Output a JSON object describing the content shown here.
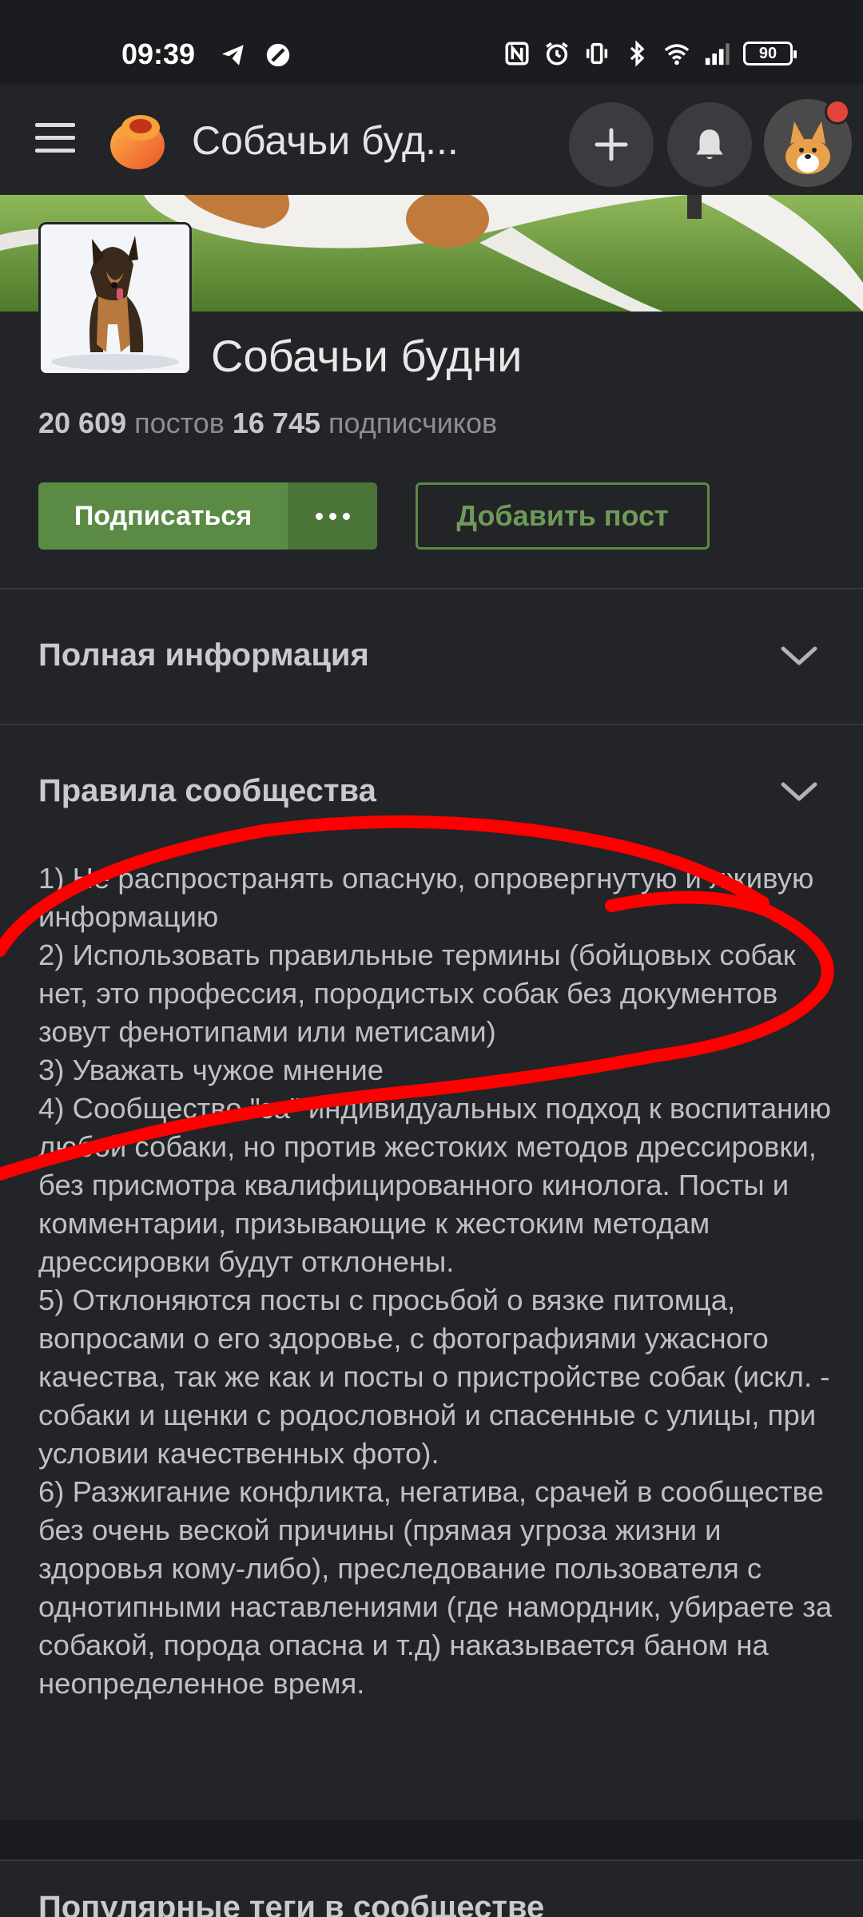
{
  "status_bar": {
    "time": "09:39",
    "battery": "90",
    "icons": [
      "telegram-icon",
      "no-disturb-icon",
      "nfc-icon",
      "alarm-icon",
      "vibrate-icon",
      "bluetooth-icon",
      "wifi-icon",
      "signal-icon"
    ]
  },
  "app_bar": {
    "title": "Собачьи буд...",
    "icons": [
      "menu-icon",
      "app-logo",
      "plus-icon",
      "bell-icon"
    ]
  },
  "community": {
    "name": "Собачьи будни",
    "posts_count": "20 609",
    "posts_label": "постов",
    "subscribers_count": "16 745",
    "subscribers_label": "подписчиков",
    "subscribe_label": "Подписаться",
    "add_post_label": "Добавить пост"
  },
  "sections": {
    "full_info": "Полная информация",
    "rules": "Правила сообщества",
    "popular_tags": "Популярные теги в сообществе"
  },
  "rules": [
    "1) Не распространять опасную, опровергнутую и лживую информацию",
    "2) Использовать правильные термины (бойцовых собак нет, это профессия, породистых собак без документов зовут фенотипами или метисами)",
    "3) Уважать чужое мнение",
    "4) Сообщество \"за\" индивидуальных подход к воспитанию любой собаки, но против жестоких методов дрессировки, без присмотра квалифицированного кинолога. Посты и комментарии, призывающие к жестоким методам дрессировки будут отклонены.",
    "5) Отклоняются посты с просьбой о вязке питомца, вопросами о его здоровье, с фотографиями ужасного качества, так же как и посты о пристройстве собак (искл. - собаки и щенки с родословной и спасенные с улицы, при условии качественных фото).",
    "6) Разжигание конфликта, негатива, срачей в сообществе без очень веской причины (прямая угроза жизни и здоровья кому-либо), преследование пользователя с однотипными наставлениями (где намордник, убираете за собакой, порода опасна и т.д) наказывается баном на неопределенное время."
  ],
  "colors": {
    "background": "#222427",
    "accent_green": "#5b8a45",
    "annotation_red": "#ff0000",
    "notification_dot": "#e0443c"
  }
}
